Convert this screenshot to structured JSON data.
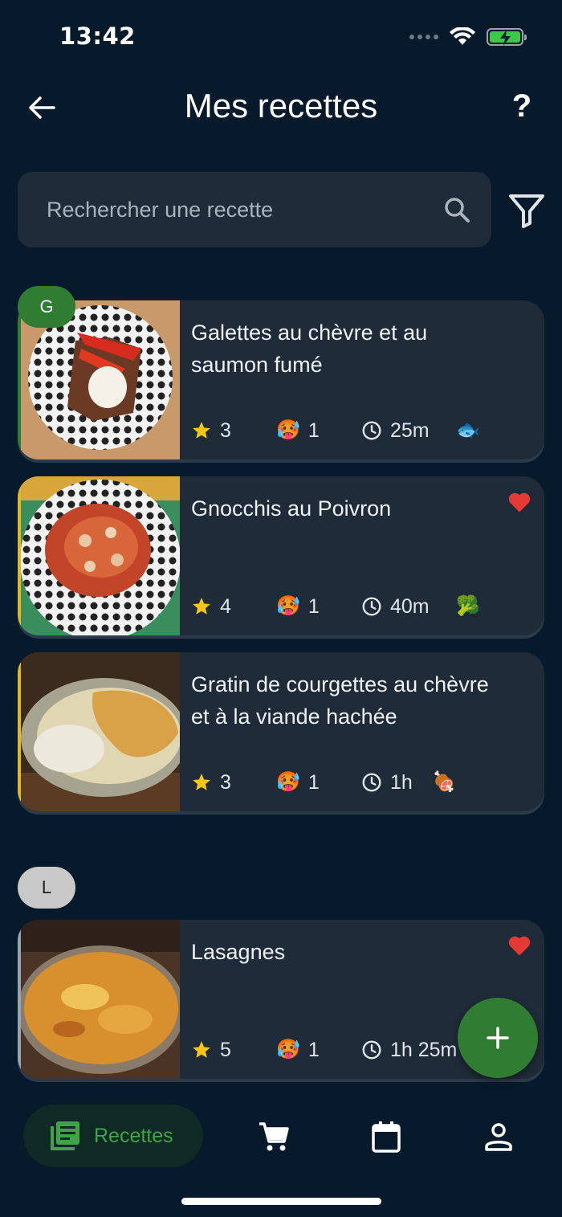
{
  "status_bar": {
    "time": "13:42"
  },
  "header": {
    "title": "Mes recettes",
    "help_label": "?"
  },
  "search": {
    "placeholder": "Rechercher une recette"
  },
  "sections": [
    {
      "letter": "G"
    },
    {
      "letter": "L"
    }
  ],
  "recipes": [
    {
      "title": "Galettes au chèvre et au saumon fumé",
      "rating": "3",
      "difficulty": "1",
      "time": "25m",
      "category_icon": "fish-icon",
      "category_glyph": "🐟",
      "favorite": false,
      "accent": "#2e7d32"
    },
    {
      "title": "Gnocchis au Poivron",
      "rating": "4",
      "difficulty": "1",
      "time": "40m",
      "category_icon": "broccoli-icon",
      "category_glyph": "🥦",
      "favorite": true,
      "accent": "#e0b825"
    },
    {
      "title": "Gratin de courgettes au chèvre et à la viande hachée",
      "rating": "3",
      "difficulty": "1",
      "time": "1h",
      "category_icon": "meat-icon",
      "category_glyph": "🍖",
      "favorite": false,
      "accent": "#e0b825"
    },
    {
      "title": "Lasagnes",
      "rating": "5",
      "difficulty": "1",
      "time": "1h 25m",
      "favorite": true,
      "accent": "#9aa3ab"
    }
  ],
  "bottom_nav": {
    "recipes_label": "Recettes"
  },
  "colors": {
    "background": "#071a2c",
    "card": "#1f2b38",
    "accent_green": "#2e7d32",
    "star": "#f5c518",
    "heart": "#e53935"
  }
}
